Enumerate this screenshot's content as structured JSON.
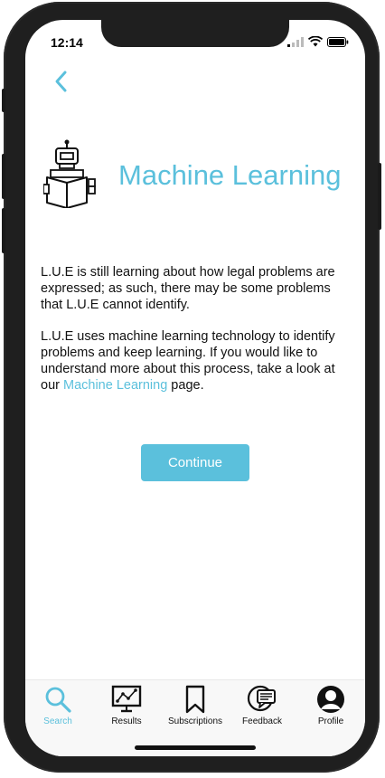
{
  "status_bar": {
    "time": "12:14"
  },
  "header": {
    "title": "Machine Learning"
  },
  "content": {
    "paragraph1": "L.U.E is still learning about how legal problems are expressed; as such, there may be some problems that L.U.E cannot identify.",
    "paragraph2_text": "L.U.E uses machine learning technology to identify problems and keep learning. If you would like to understand more about this process, take a look at our ",
    "paragraph2_link": "Machine Learning",
    "paragraph2_end": " page."
  },
  "continue_button": {
    "label": "Continue"
  },
  "tab_bar": {
    "items": [
      {
        "label": "Search",
        "icon": "search-icon",
        "active": true
      },
      {
        "label": "Results",
        "icon": "results-icon",
        "active": false
      },
      {
        "label": "Subscriptions",
        "icon": "bookmark-icon",
        "active": false
      },
      {
        "label": "Feedback",
        "icon": "feedback-icon",
        "active": false
      },
      {
        "label": "Profile",
        "icon": "profile-icon",
        "active": false
      }
    ]
  },
  "colors": {
    "accent": "#5bc0dc",
    "text": "#111111",
    "background": "#ffffff"
  }
}
